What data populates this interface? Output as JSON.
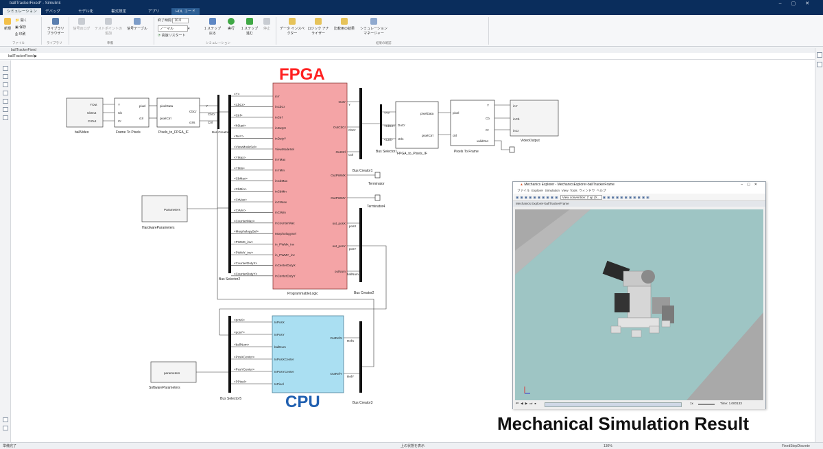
{
  "window": {
    "title": "ballTrackerFixed* - Simulink"
  },
  "tabs": [
    "シミュレーション",
    "デバッグ",
    "モデル化",
    "書式設定",
    "アプリ",
    "HDL コード"
  ],
  "ribbon": {
    "file_items": [
      "新規",
      "開く",
      "保存",
      "印刷"
    ],
    "file_group": "ファイル",
    "library_btn": "ライブラリ ブラウザー",
    "library_group": "ライブラリ",
    "prepare_btns": [
      "信号のログ",
      "テストポイントの追加",
      "信号テーブル"
    ],
    "prepare_group": "準備",
    "stop_time_label": "終了時間",
    "stop_time": "10.0",
    "mode_value": "ノーマル",
    "fast_restart": "高速リスタート",
    "sim_btns": [
      "1 ステップ戻る",
      "実行",
      "1 ステップ進む",
      "停止"
    ],
    "sim_group": "シミュレーション",
    "review_btns": [
      "データ インスペクター",
      "ロジック アナライザー",
      "比較用の結果",
      "シミュレーション マネージャー"
    ],
    "review_group": "結果の確認"
  },
  "breadcrumb": {
    "model": "ballTrackerFixed",
    "path": "ballTrackerFixed ▶"
  },
  "status": {
    "left": "準備完了",
    "center": "上の状態を表示",
    "zoom": "130%",
    "right": "FixedStepDiscrete"
  },
  "overlays": {
    "fpga": "FPGA",
    "cpu": "CPU",
    "mech_result": "Mechanical Simulation Result"
  },
  "colors": {
    "fpga_fill": "#f4a4a6",
    "fpga_text": "#ff2020",
    "cpu_fill": "#aadff2",
    "cpu_text": "#1f5fb0",
    "title_bg": "#0a2d5c"
  },
  "blocks": {
    "ballVideo": {
      "name": "ballVideo",
      "ports": [
        "YOut",
        "CbOut",
        "CrOut"
      ]
    },
    "frameToPixels": {
      "name": "Frame To Pixels",
      "in_ports": [
        "Y",
        "Cb",
        "Cr"
      ],
      "out_ports": [
        "pixel",
        "ctrl"
      ]
    },
    "pixelsToFpga": {
      "name": "Pixels_to_FPGA_IF",
      "in_ports": [
        "pixelData",
        "pixelCtrl"
      ],
      "out_ports": [
        "CbCr",
        "ctrls"
      ]
    },
    "busCreator": {
      "name": "Bus Creator",
      "out": "Y",
      "in": [
        "Y",
        "CbCr",
        "Ctrl"
      ]
    },
    "busSelector2": {
      "name": "Bus Selector2",
      "signals": [
        "<Y>",
        "<CbCr>",
        "<Ctrl>",
        "<hStart>",
        "<NuY>",
        "<ViewModeSel>",
        "<YMax>",
        "<YMin>",
        "<CbMax>",
        "<CbMin>",
        "<CrMax>",
        "<CrMin>",
        "<CounterMax>",
        "<MorphologySel>",
        "<PWMX_inv>",
        "<PWMY_inv>",
        "<CounterDutyX>",
        "<CounterDutyY>"
      ]
    },
    "programmableLogic": {
      "name": "ProgrammableLogic",
      "in_ports": [
        "inY",
        "inCbCr",
        "inCtrl",
        "inDutyX",
        "inDutyY",
        "ViewModeSel",
        "inYMax",
        "inYMin",
        "inCbMax",
        "inCbMin",
        "inCrMax",
        "inCrMin",
        "inCounterMax",
        "MorphologySel",
        "in_PWMx_inv",
        "in_PWMY_inv",
        "inCenterDutyX",
        "inCenterDutyY"
      ],
      "out_ports": [
        "OutY",
        "OutCbCr",
        "OutCtrl",
        "OutPWMX",
        "OutPWMY",
        "out_posX",
        "out_posY",
        "outNum"
      ]
    },
    "busCreator1": {
      "name": "Bus Creator1",
      "signals": [
        "Y",
        "CbCr",
        "Ctrl"
      ]
    },
    "busCreator2": {
      "name": "Bus Creator2",
      "signals": [
        "posX",
        "posY",
        "ballNum"
      ]
    },
    "terminator": {
      "name": "Terminator"
    },
    "terminator4": {
      "name": "Terminator4"
    },
    "busSelector1": {
      "name": "Bus Selector1",
      "signals": [
        "<Y>",
        "<CbCr>",
        "<Ctrl>"
      ]
    },
    "fpgaToPixels": {
      "name": "FPGA_to_Pixels_IF",
      "in_ports": [
        "DuCr",
        "ctrls"
      ],
      "out_ports": [
        "pixelData",
        "pixelCtrl"
      ]
    },
    "pixelsToFrame": {
      "name": "Pixels To Frame",
      "in_ports": [
        "pixel",
        "ctrl"
      ],
      "out_ports": [
        "Y",
        "Cb",
        "Cr",
        "validOut"
      ]
    },
    "videoOutput": {
      "name": "VideoOutput",
      "ports": [
        "inY",
        "inCb",
        "inCr"
      ]
    },
    "hardwareParams": {
      "name": "HardwareParameters",
      "label": "Parameters"
    },
    "softwareParams": {
      "name": "SoftwareParameters",
      "label": "parameters"
    },
    "busSelector5": {
      "name": "Bus Selector5",
      "signals": [
        "<posX>",
        "<posY>",
        "<ballNum>",
        "<PosXCenter>",
        "<PosYCenter>",
        "<PPixel>"
      ]
    },
    "cpuBlock": {
      "name": "CPU",
      "in_ports": [
        "InPosX",
        "InPosY",
        "ballNum",
        "InPosXCenter",
        "InPosYCenter",
        "InPixel"
      ],
      "out_ports": [
        "OutRefX",
        "OutRefY"
      ]
    },
    "busCreator3": {
      "name": "Bus Creator3",
      "signals": [
        "RefX",
        "RefY"
      ]
    }
  },
  "mech": {
    "title": "Mechanics Explorer - MechanicsExplorer-ballTrackerFrame",
    "menu": [
      "ファイル",
      "Explorer",
      "Simulation",
      "View",
      "Tools",
      "ウィンドウ",
      "ヘルプ"
    ],
    "view_label": "View convention: Z up (X...",
    "tab": "Mechanics Explorer-ballTrackerFrame",
    "time_label": "Time: 1.000133",
    "speed": "1x"
  }
}
